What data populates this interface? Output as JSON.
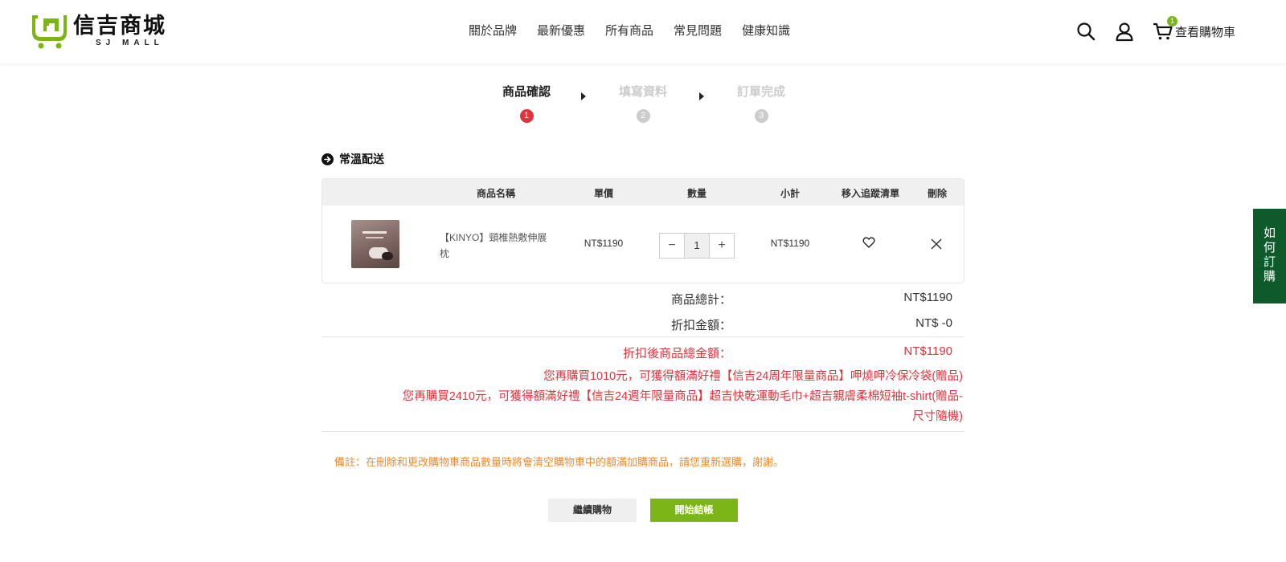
{
  "header": {
    "logo_cn": "信吉商城",
    "logo_en": "SJ MALL",
    "nav": [
      "關於品牌",
      "最新優惠",
      "所有商品",
      "常見問題",
      "健康知識"
    ],
    "cart_count": "1",
    "cart_label": "查看購物車",
    "icons": [
      "search-icon",
      "user-icon",
      "cart-icon"
    ]
  },
  "steps": [
    {
      "label": "商品確認",
      "num": "1",
      "active": true
    },
    {
      "label": "填寫資料",
      "num": "2",
      "active": false
    },
    {
      "label": "訂單完成",
      "num": "3",
      "active": false
    }
  ],
  "section_title": "常溫配送",
  "table": {
    "headers": {
      "name": "商品名稱",
      "price": "單價",
      "qty": "數量",
      "subtotal": "小計",
      "wishlist": "移入追蹤清單",
      "delete": "刪除"
    },
    "rows": [
      {
        "name": "【KINYO】頸椎熱敷伸展枕",
        "price": "NT$1190",
        "qty": "1",
        "subtotal": "NT$1190"
      }
    ]
  },
  "totals": {
    "goods_label": "商品總計：",
    "goods_value": "NT$1190",
    "discount_label": "折扣金額：",
    "discount_value": "NT$ -0",
    "final_label": "折扣後商品總金額：",
    "final_value": "NT$1190"
  },
  "promos": [
    "您再購買1010元，可獲得額滿好禮【信吉24周年限量商品】呷燒呷冷保冷袋(贈品)",
    "您再購買2410元，可獲得額滿好禮【信吉24週年限量商品】超吉快乾運動毛巾+超吉親膚柔棉短袖t-shirt(贈品-尺寸隨機)"
  ],
  "note": "備註：在刪除和更改購物車商品數量時將會清空購物車中的額滿加購商品，請您重新選購，謝謝。",
  "buttons": {
    "continue": "繼續購物",
    "checkout": "開始結帳"
  },
  "side_tab": "如何訂購",
  "colors": {
    "brand_green": "#7cb518",
    "accent_red": "#e0343d",
    "note_orange": "#f08a2c",
    "side_tab_green": "#0f5a2a"
  }
}
